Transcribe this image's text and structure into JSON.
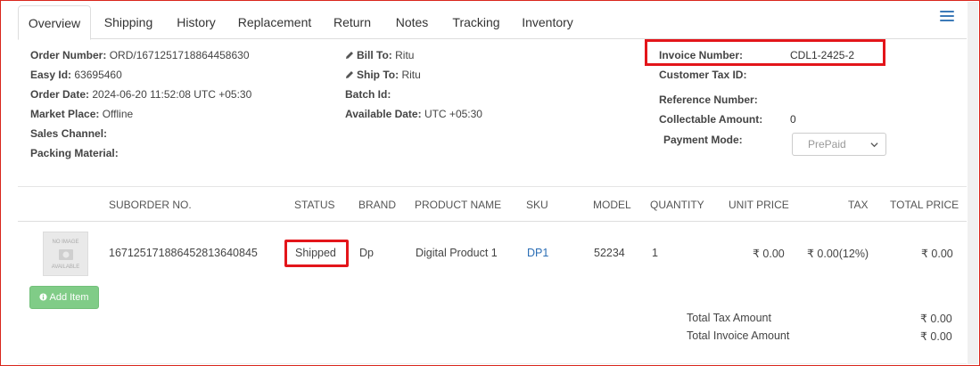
{
  "tabs": [
    {
      "label": "Overview",
      "active": true
    },
    {
      "label": "Shipping"
    },
    {
      "label": "History"
    },
    {
      "label": "Replacement"
    },
    {
      "label": "Return"
    },
    {
      "label": "Notes"
    },
    {
      "label": "Tracking"
    },
    {
      "label": "Inventory"
    }
  ],
  "order": {
    "order_number_label": "Order Number:",
    "order_number": "ORD/16712517188644586​30",
    "easy_id_label": "Easy Id:",
    "easy_id": "63695460",
    "order_date_label": "Order Date:",
    "order_date": "2024-06-20 11:52:08 UTC +05:30",
    "market_place_label": "Market Place:",
    "market_place": "Offline",
    "sales_channel_label": "Sales Channel:",
    "packing_material_label": "Packing Material:"
  },
  "address": {
    "bill_to_label": "Bill To:",
    "bill_to": "Ritu",
    "ship_to_label": "Ship To:",
    "ship_to": "Ritu",
    "batch_id_label": "Batch Id:",
    "available_date_label": "Available Date:",
    "available_date": "UTC +05:30"
  },
  "invoice": {
    "invoice_number_label": "Invoice Number:",
    "invoice_number": "CDL1-2425-2",
    "customer_tax_id_label": "Customer Tax ID:",
    "reference_number_label": "Reference Number:",
    "collectable_amount_label": "Collectable Amount:",
    "collectable_amount": "0",
    "payment_mode_label": "Payment Mode:",
    "payment_mode": "PrePaid"
  },
  "table": {
    "headers": {
      "suborder": "SUBORDER NO.",
      "status": "STATUS",
      "brand": "BRAND",
      "product_name": "PRODUCT NAME",
      "sku": "SKU",
      "model": "MODEL",
      "quantity": "QUANTITY",
      "unit_price": "UNIT PRICE",
      "tax": "TAX",
      "total_price": "TOTAL PRICE"
    },
    "rows": [
      {
        "image_text_top": "NO IMAGE",
        "image_text_bottom": "AVAILABLE",
        "suborder": "167125171886452813640845",
        "status": "Shipped",
        "brand": "Dp",
        "product_name": "Digital Product 1",
        "sku": "DP1",
        "model": "52234",
        "quantity": "1",
        "unit_price": "₹ 0.00",
        "tax": "₹ 0.00(12%)",
        "total_price": "₹ 0.00"
      }
    ]
  },
  "add_item_label": "Add Item",
  "totals": {
    "tax_label": "Total Tax Amount",
    "tax_value": "₹ 0.00",
    "invoice_label": "Total Invoice Amount",
    "invoice_value": "₹ 0.00"
  },
  "colors": {
    "accent": "#2a6db5",
    "highlight": "#e3151a",
    "button": "#80cc87"
  }
}
